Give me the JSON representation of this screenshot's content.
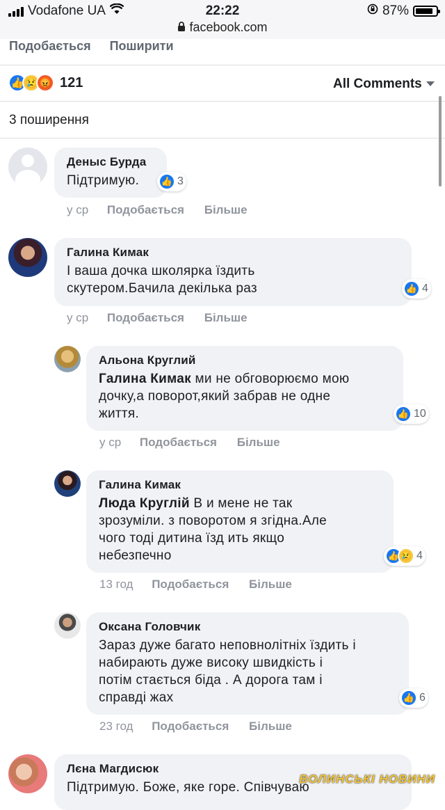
{
  "status_bar": {
    "carrier": "Vodafone UA",
    "time": "22:22",
    "battery": "87%",
    "battery_level": 0.87
  },
  "url_bar": {
    "url": "facebook.com"
  },
  "post_actions": {
    "like": "Подобається",
    "share": "Поширити"
  },
  "reactions": {
    "count": "121",
    "icons": [
      "like-icon",
      "sad-icon",
      "angry-icon"
    ]
  },
  "comments_filter": {
    "label": "All Comments"
  },
  "shares": {
    "label": "3 поширення"
  },
  "comments": [
    {
      "name": "Деныс Бурда",
      "text": "Підтримую.",
      "reaction_count": "3",
      "time": "у ср",
      "like": "Подобається",
      "more": "Більше"
    },
    {
      "name": "Галина Кимак",
      "text": "І ваша дочка школярка їздить\nскутером.Бачила декілька раз",
      "reaction_count": "4",
      "time": "у ср",
      "like": "Подобається",
      "more": "Більше",
      "replies": [
        {
          "name": "Альона Круглий",
          "mention": "Галина Кимак",
          "text": " ми не обговорюємо мою\nдочку,а поворот,який забрав не одне\nжиття.",
          "reaction_count": "10",
          "time": "у ср",
          "like": "Подобається",
          "more": "Більше"
        },
        {
          "name": "Галина Кимак",
          "mention": "Люда Круглій",
          "text": " В и мене не так\nзрозуміли. з поворотом я згідна.Але\nчого тоді дитина їзд ить якщо\nнебезпечно",
          "reaction_count": "4",
          "time": "13 год",
          "like": "Подобається",
          "more": "Більше"
        },
        {
          "name": "Оксана Головчик",
          "text": "Зараз дуже багато неповнолітніх їздить і\nнабирають дуже високу швидкість і\nпотім стається біда . А дорога там і\nсправді жах",
          "reaction_count": "6",
          "time": "23 год",
          "like": "Подобається",
          "more": "Більше"
        }
      ]
    },
    {
      "name": "Лєна Магдисюк",
      "text": "Підтримую. Боже, яке горе. Співчуваю"
    }
  ],
  "watermark": "ВОЛИНСЬКІ НОВИНИ",
  "colors": {
    "like_blue": "#1877f2",
    "bubble_bg": "#f0f2f5",
    "meta_gray": "#90949c"
  }
}
